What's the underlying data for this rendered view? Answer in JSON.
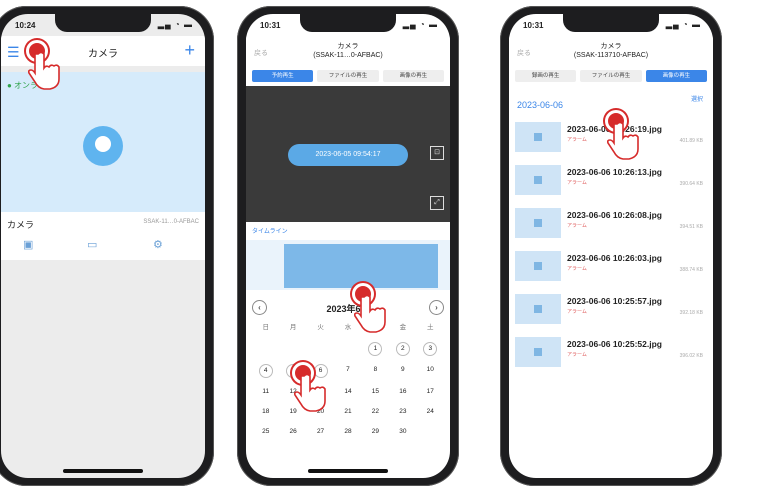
{
  "phone1": {
    "time": "10:24",
    "header_title": "カメラ",
    "online_status": "● オンライン",
    "device_name": "カメラ",
    "device_serial": "SSAK-11…0-AFBAC"
  },
  "phone2": {
    "time": "10:31",
    "title_line1": "カメラ",
    "title_line2": "(SSAK-11…0-AFBAC)",
    "back_label": "戻る",
    "tabs": [
      "予約再生",
      "ファイルの再生",
      "画像の再生"
    ],
    "video_timestamp": "2023-06-05 09:54:17",
    "segment_label": "タイムライン",
    "month_label": "2023年6月",
    "weekdays": [
      "日",
      "月",
      "火",
      "水",
      "木",
      "金",
      "土"
    ],
    "days_row1": [
      "",
      "",
      "",
      "",
      "1",
      "2",
      "3"
    ],
    "days_row2": [
      "4",
      "5",
      "6",
      "7",
      "8",
      "9",
      "10"
    ],
    "days_row3": [
      "11",
      "12",
      "13",
      "14",
      "15",
      "16",
      "17"
    ],
    "days_row4": [
      "18",
      "19",
      "20",
      "21",
      "22",
      "23",
      "24"
    ],
    "days_row5": [
      "25",
      "26",
      "27",
      "28",
      "29",
      "30",
      ""
    ]
  },
  "phone3": {
    "time": "10:31",
    "title_line1": "カメラ",
    "title_line2": "(SSAK-113710-AFBAC)",
    "back_label": "戻る",
    "tabs": [
      "録画の再生",
      "ファイルの再生",
      "画像の再生"
    ],
    "date_label": "2023-06-06",
    "select_label": "選択",
    "files": [
      {
        "name": "2023-06-06 10:26:19.jpg",
        "tag": "アラーム",
        "size": "401.89 KB"
      },
      {
        "name": "2023-06-06 10:26:13.jpg",
        "tag": "アラーム",
        "size": "390.64 KB"
      },
      {
        "name": "2023-06-06 10:26:08.jpg",
        "tag": "アラーム",
        "size": "394.51 KB"
      },
      {
        "name": "2023-06-06 10:26:03.jpg",
        "tag": "アラーム",
        "size": "388.74 KB"
      },
      {
        "name": "2023-06-06 10:25:57.jpg",
        "tag": "アラーム",
        "size": "392.18 KB"
      },
      {
        "name": "2023-06-06 10:25:52.jpg",
        "tag": "アラーム",
        "size": "396.02 KB"
      }
    ]
  },
  "colors": {
    "accent": "#3b86e8",
    "tap": "#d62b2b",
    "card": "#d6ebfb"
  }
}
